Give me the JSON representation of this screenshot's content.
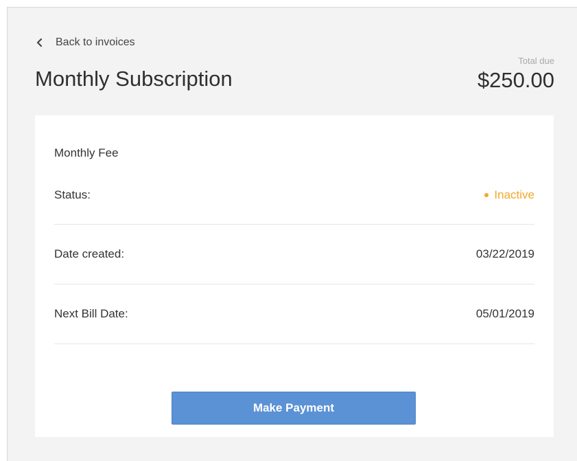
{
  "header": {
    "back_label": "Back to invoices",
    "title": "Monthly Subscription",
    "total_label": "Total due",
    "total_amount": "$250.00"
  },
  "card": {
    "fee_title": "Monthly Fee",
    "rows": [
      {
        "label": "Status:",
        "value": "Inactive"
      },
      {
        "label": "Date created:",
        "value": "03/22/2019"
      },
      {
        "label": "Next Bill Date:",
        "value": "05/01/2019"
      }
    ],
    "pay_button_label": "Make Payment"
  },
  "colors": {
    "status_inactive": "#f4a62a",
    "button": "#5b92d5"
  },
  "icons": {
    "back": "chevron-left-icon",
    "status": "status-dot-icon"
  }
}
